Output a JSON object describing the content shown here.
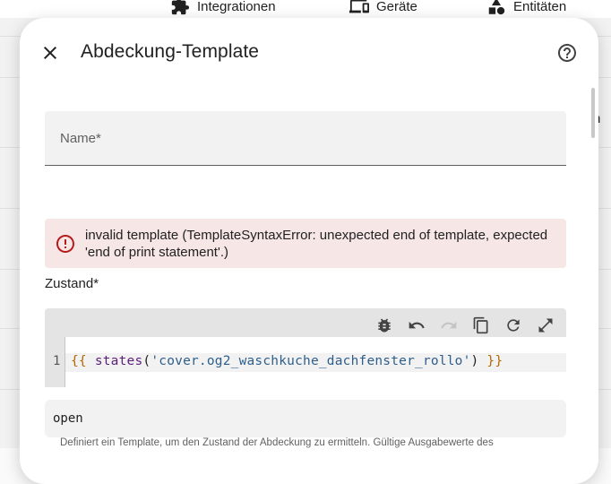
{
  "background_tabs": [
    {
      "label": "Integrationen",
      "icon": "puzzle-icon"
    },
    {
      "label": "Geräte",
      "icon": "devices-icon"
    },
    {
      "label": "Entitäten",
      "icon": "shapes-icon"
    }
  ],
  "background_right_letter": "n",
  "dialog": {
    "title": "Abdeckung-Template",
    "close_icon": "close-icon",
    "help_icon": "help-circle-icon",
    "name_field": {
      "label": "Name*",
      "value": ""
    },
    "error": {
      "icon": "alert-circle-icon",
      "message": "invalid template (TemplateSyntaxError: unexpected end of template, expected 'end of print statement'.)",
      "color": "#b71c1c"
    },
    "state_label": "Zustand*",
    "editor": {
      "toolbar": [
        "bug-icon",
        "undo-icon",
        "redo-icon",
        "copy-icon",
        "refresh-icon",
        "fullscreen-icon"
      ],
      "line_number": "1",
      "code_open_brace": "{{",
      "code_fn": "states",
      "code_paren_open": "(",
      "code_string": "'cover.og2_waschkuche_dachfenster_rollo'",
      "code_paren_close": ")",
      "code_close_brace": "}}"
    },
    "result": "open",
    "helper_text": "Definiert ein Template, um den Zustand der Abdeckung zu ermitteln. Gültige Ausgabewerte des"
  }
}
